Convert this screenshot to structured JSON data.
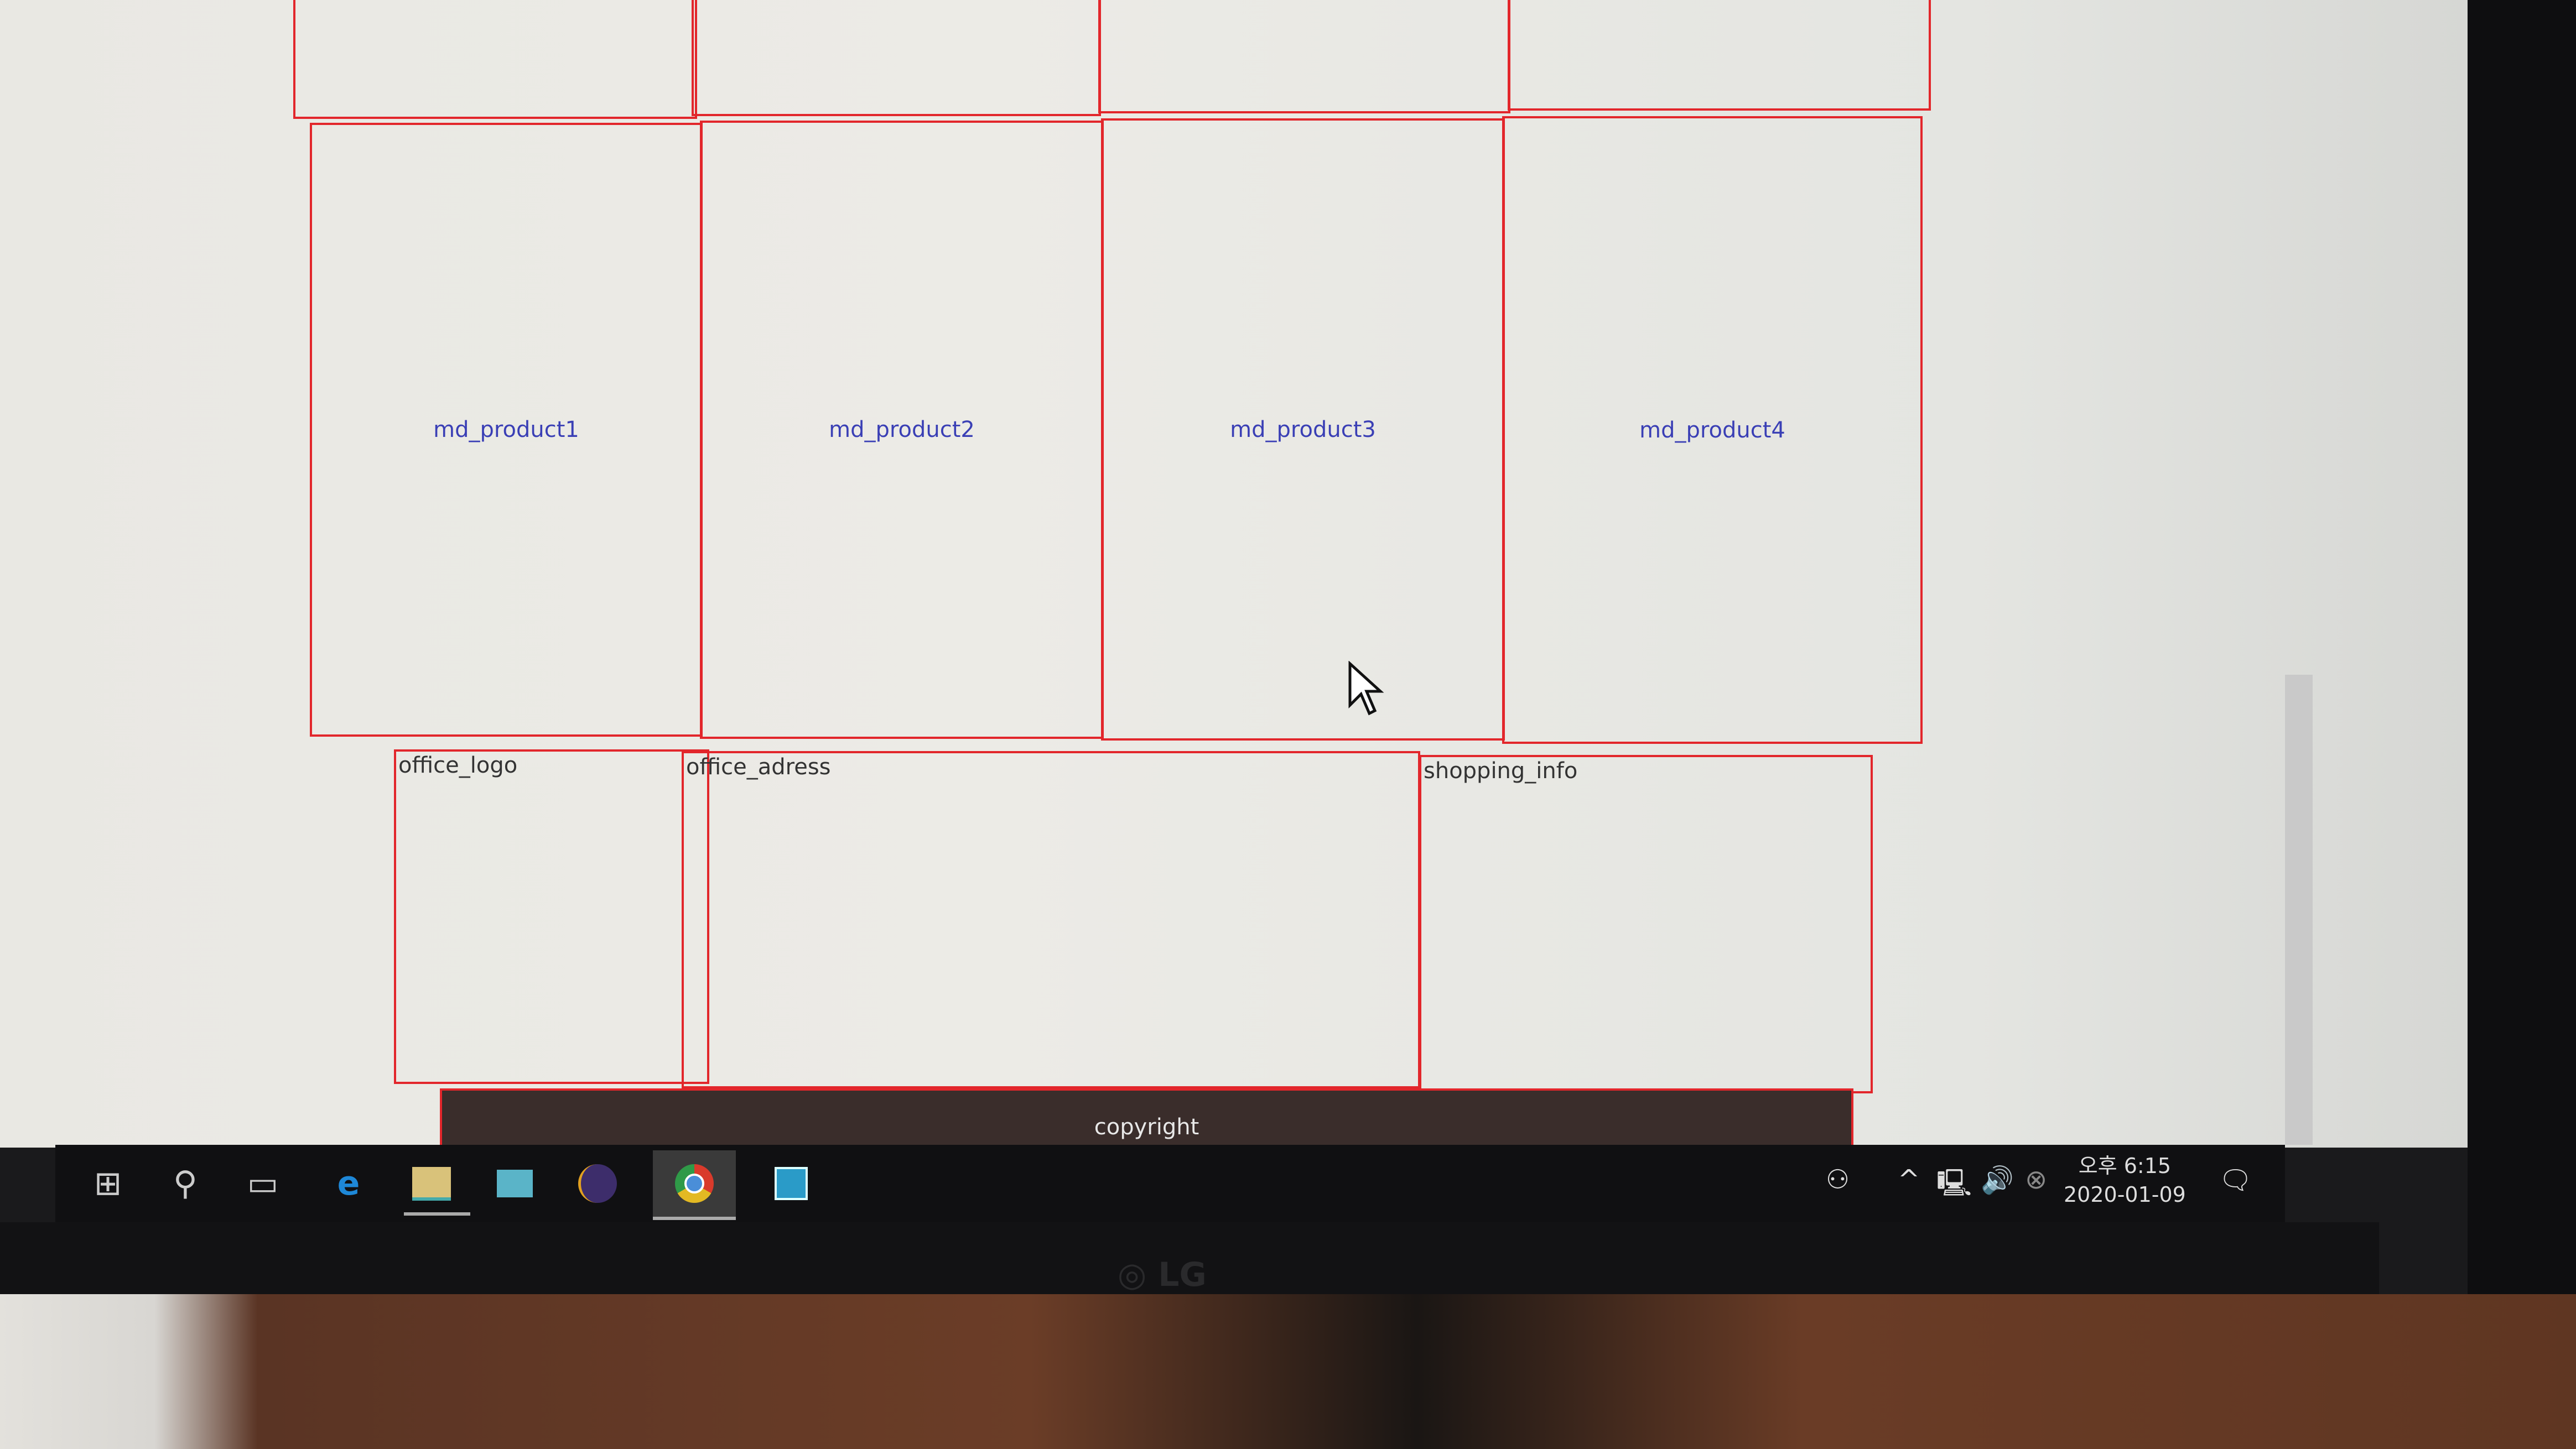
{
  "products": [
    {
      "label": "md_product1"
    },
    {
      "label": "md_product2"
    },
    {
      "label": "md_product3"
    },
    {
      "label": "md_product4"
    }
  ],
  "footer": {
    "office_logo": "office_logo",
    "office_adress": "office_adress",
    "shopping_info": "shopping_info",
    "copyright": "copyright"
  },
  "taskbar": {
    "icons": [
      "windows-start-icon",
      "search-icon",
      "task-view-icon",
      "edge-icon",
      "file-explorer-icon",
      "remote-desktop-icon",
      "eclipse-icon",
      "chrome-icon",
      "app-icon"
    ],
    "time": "오후 6:15",
    "date": "2020-01-09"
  },
  "monitor": {
    "brand": "LG"
  },
  "colors": {
    "border": "#e2262b",
    "link": "#3a3fb5",
    "footer_bar": "#3a2d2b"
  }
}
